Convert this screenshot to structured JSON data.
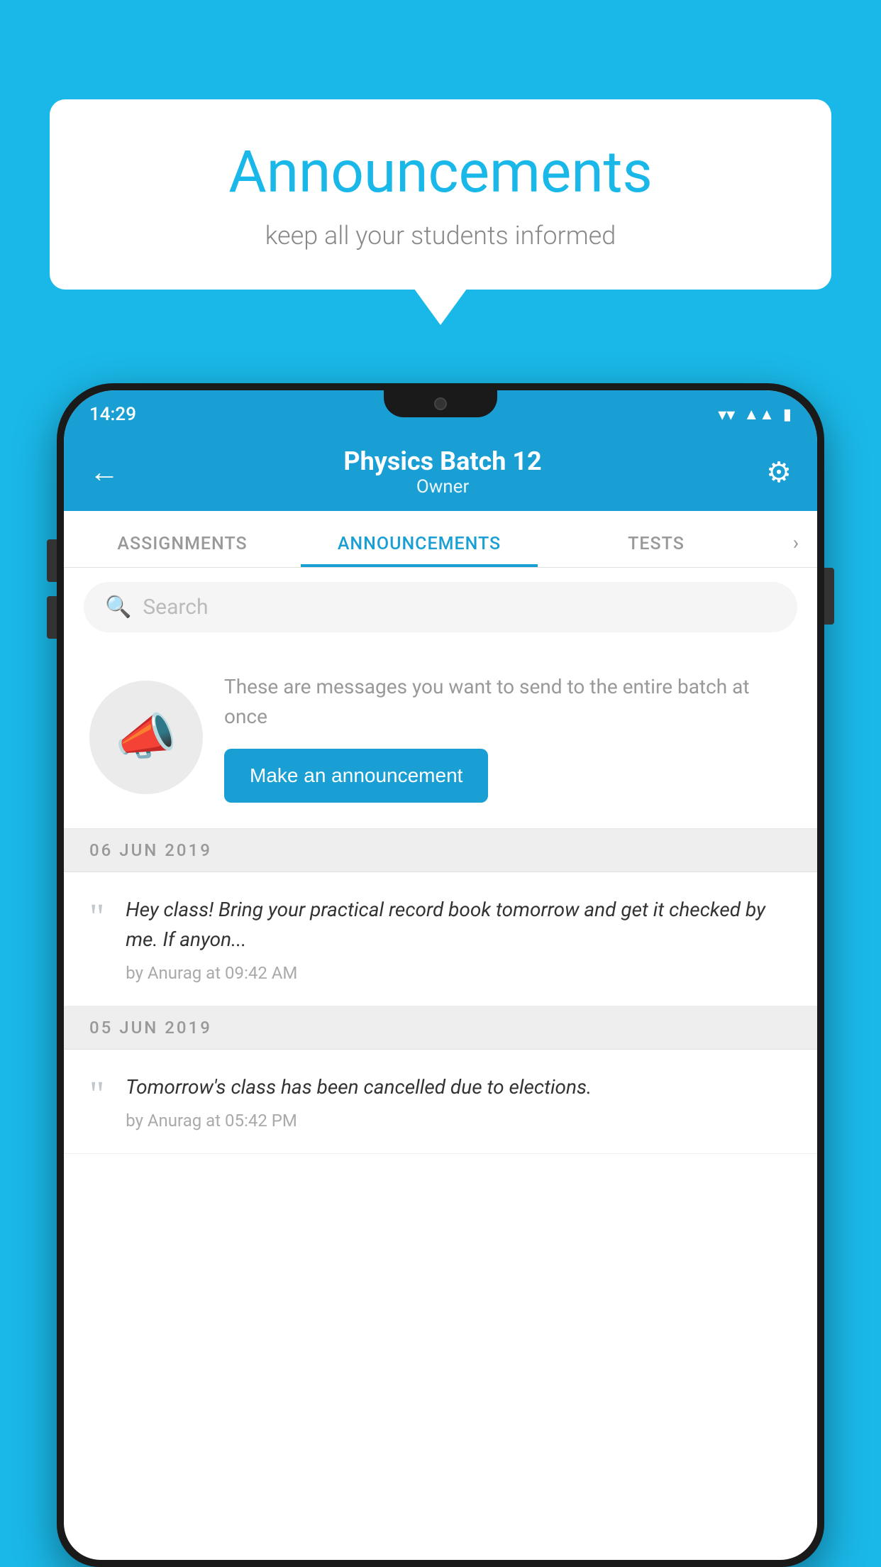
{
  "header": {
    "title": "Announcements",
    "subtitle": "keep all your students informed"
  },
  "phone": {
    "status_bar": {
      "time": "14:29"
    },
    "app_header": {
      "title": "Physics Batch 12",
      "subtitle": "Owner",
      "back_label": "←",
      "settings_label": "⚙"
    },
    "tabs": [
      {
        "label": "ASSIGNMENTS",
        "active": false
      },
      {
        "label": "ANNOUNCEMENTS",
        "active": true
      },
      {
        "label": "TESTS",
        "active": false
      }
    ],
    "search": {
      "placeholder": "Search"
    },
    "promo": {
      "description": "These are messages you want to send to the entire batch at once",
      "button_label": "Make an announcement"
    },
    "announcements": [
      {
        "date": "06  JUN  2019",
        "text": "Hey class! Bring your practical record book tomorrow and get it checked by me. If anyon...",
        "meta": "by Anurag at 09:42 AM"
      },
      {
        "date": "05  JUN  2019",
        "text": "Tomorrow's class has been cancelled due to elections.",
        "meta": "by Anurag at 05:42 PM"
      }
    ]
  },
  "colors": {
    "primary": "#1a9fd4",
    "background": "#1ab8e8",
    "white": "#ffffff"
  }
}
